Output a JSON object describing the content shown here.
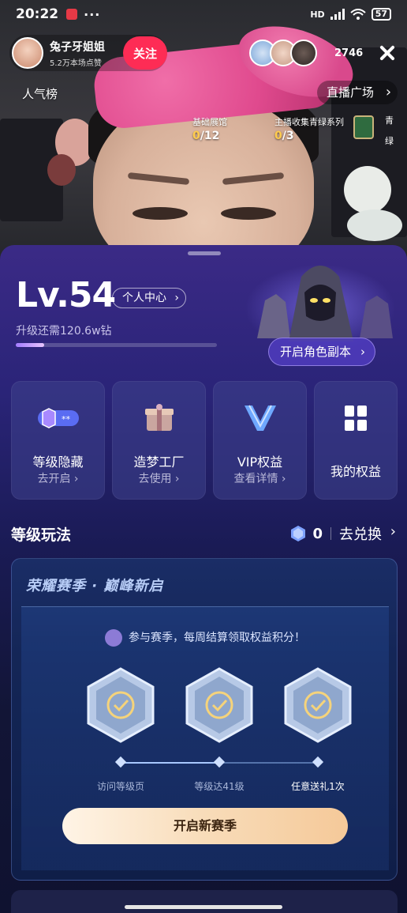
{
  "status_bar": {
    "time": "20:22",
    "more": "···",
    "network": "HD",
    "battery": "57"
  },
  "stream": {
    "anchor_name": "兔子牙姐姐",
    "anchor_likes": "5.2万本场点赞",
    "follow_label": "关注",
    "viewer_count": "2746",
    "popular_label": "人气榜",
    "plaza_label": "直播广场",
    "gallery": [
      {
        "label": "基础展馆",
        "current": "0",
        "total": "/12"
      },
      {
        "label": "主播收集青绿系列",
        "current": "0",
        "total": "/3"
      }
    ],
    "side_chars": [
      "青",
      "绿"
    ]
  },
  "level_panel": {
    "level": "Lv.54",
    "center_label": "个人中心",
    "upgrade_text": "升级还需120.6w钻",
    "xp_progress": 0.14,
    "role_button": "开启角色副本"
  },
  "perks": [
    {
      "title": "等级隐藏",
      "sub": "去开启",
      "icon": "hide-badge-icon"
    },
    {
      "title": "造梦工厂",
      "sub": "去使用",
      "icon": "gift-box-icon"
    },
    {
      "title": "VIP权益",
      "sub": "查看详情",
      "icon": "vip-v-icon"
    },
    {
      "title": "我的权益",
      "sub": "",
      "icon": "grid-icon"
    }
  ],
  "gameplay": {
    "title": "等级玩法",
    "gem_count": "0",
    "exchange_label": "去兑换"
  },
  "season": {
    "banner": "荣耀赛季 · 巅峰新启",
    "note": "参与赛季，每周结算领取权益积分！",
    "steps": [
      "访问等级页",
      "等级达41级",
      "任意送礼1次"
    ],
    "cta": "开启新赛季"
  },
  "colors": {
    "accent": "#fe2c55",
    "gold": "#ffcc4d",
    "panel_top": "#3b2a86"
  }
}
